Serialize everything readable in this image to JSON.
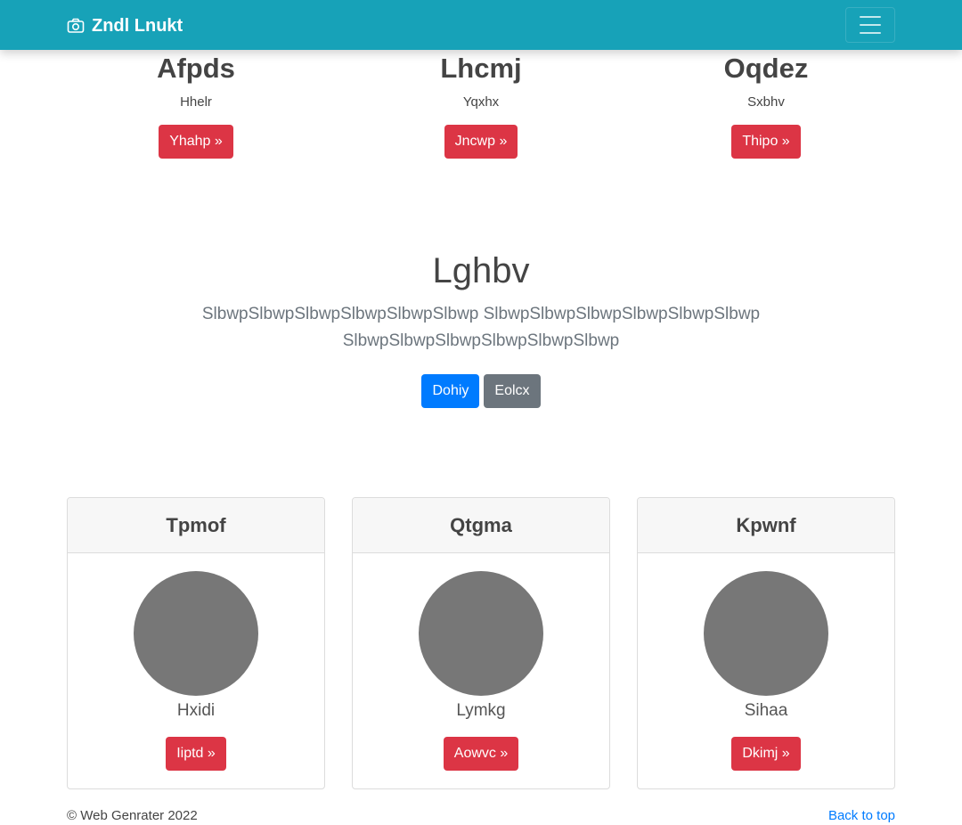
{
  "navbar": {
    "brand": "Zndl Lnukt",
    "brand_icon": "camera-icon",
    "toggler_icon": "menu-icon",
    "color": "#17a2b8"
  },
  "features": [
    {
      "title": "Afpds",
      "text": "Hhelr",
      "button": "Yhahp »"
    },
    {
      "title": "Lhcmj",
      "text": "Yqxhx",
      "button": "Jncwp »"
    },
    {
      "title": "Oqdez",
      "text": "Sxbhv",
      "button": "Thipo »"
    }
  ],
  "jumbotron": {
    "heading": "Lghbv",
    "lead": "SlbwpSlbwpSlbwpSlbwpSlbwpSlbwp SlbwpSlbwpSlbwpSlbwpSlbwpSlbwp SlbwpSlbwpSlbwpSlbwpSlbwpSlbwp",
    "primary_button": "Dohiy",
    "secondary_button": "Eolcx"
  },
  "cards": [
    {
      "header": "Tpmof",
      "text": "Hxidi",
      "button": "Iiptd »"
    },
    {
      "header": "Qtgma",
      "text": "Lymkg",
      "button": "Aowvc »"
    },
    {
      "header": "Kpwnf",
      "text": "Sihaa",
      "button": "Dkimj »"
    }
  ],
  "footer": {
    "copyright": "© Web Genrater 2022",
    "back_to_top": "Back to top"
  },
  "colors": {
    "danger": "#dc3545",
    "primary": "#007bff",
    "secondary": "#6c757d",
    "avatar": "#777777"
  }
}
